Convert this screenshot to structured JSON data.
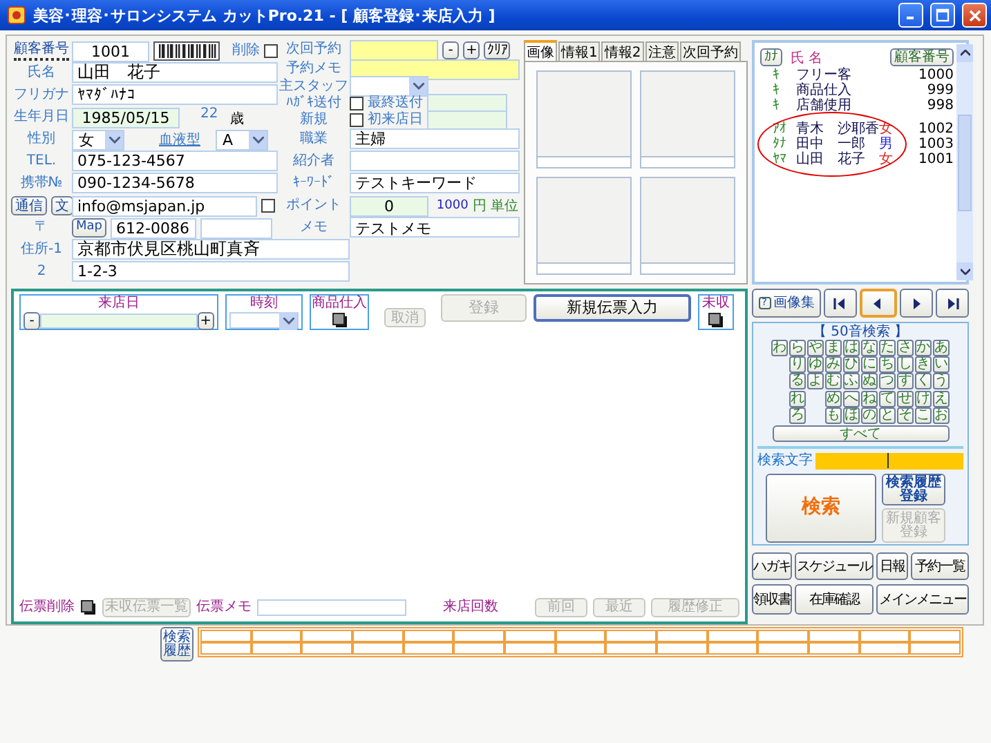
{
  "window": {
    "title": "美容･理容･サロンシステム カットPro.21 - [ 顧客登録･来店入力 ]"
  },
  "customer": {
    "id": {
      "label": "顧客番号",
      "value": "1001"
    },
    "delete": {
      "label": "削除",
      "checked": false
    },
    "name": {
      "label": "氏名",
      "value": "山田　花子"
    },
    "kana": {
      "label": "フリガナ",
      "value": "ﾔﾏﾀﾞﾊﾅｺ"
    },
    "birthday": {
      "label": "生年月日",
      "value": "1985/05/15"
    },
    "age": {
      "value": "22",
      "unit": "歳"
    },
    "sex": {
      "label": "性別",
      "value": "女"
    },
    "blood_type": {
      "label": "血液型",
      "value": "A"
    },
    "tel": {
      "label": "TEL.",
      "value": "075-123-4567"
    },
    "mobile": {
      "label": "携帯№",
      "value": "090-1234-5678"
    },
    "email": {
      "buttons": [
        {
          "label": "通信",
          "disabled": false
        },
        {
          "label": "文",
          "disabled": false
        }
      ],
      "value": "info@msjapan.jp",
      "checked": false
    },
    "zip": {
      "label": "〒",
      "button": "Map",
      "value": "612-0086"
    },
    "address1": {
      "label": "住所-1",
      "value": "京都市伏見区桃山町真斉"
    },
    "address2": {
      "label": "2",
      "value": "1-2-3"
    }
  },
  "details": {
    "next_reservation": {
      "label": "次回予約",
      "buttons": [
        "-",
        "+",
        "ｸﾘｱ"
      ]
    },
    "reservation_memo": {
      "label": "予約メモ"
    },
    "main_staff": {
      "label": "主スタッフ"
    },
    "postcard": {
      "label": "ﾊｶﾞｷ送付",
      "checked": false,
      "date_label": "最終送付"
    },
    "new_customer": {
      "label": "新規",
      "checked": false,
      "date_label": "初来店日"
    },
    "occupation": {
      "label": "職業",
      "value": "主婦"
    },
    "referrer": {
      "label": "紹介者"
    },
    "keyword": {
      "label": "ｷｰﾜｰﾄﾞ",
      "value": "テストキーワード"
    },
    "points": {
      "label": "ポイント",
      "value": "0",
      "unit_amount": "1000",
      "unit": "円 単位"
    },
    "memo": {
      "label": "メモ",
      "value": "テストメモ"
    }
  },
  "tabs": [
    {
      "label": "画像",
      "selected": true
    },
    {
      "label": "情報1",
      "selected": false
    },
    {
      "label": "情報2",
      "selected": false
    },
    {
      "label": "注意",
      "selected": false
    },
    {
      "label": "次回予約",
      "selected": false
    }
  ],
  "customer_list": {
    "kana_button": "ｶﾅ",
    "name_header": "氏 名",
    "id_button": "顧客番号",
    "rows": [
      {
        "kana": "ｷ",
        "name": "フリー客",
        "id": "1000",
        "circled": false
      },
      {
        "kana": "ｷ",
        "name": "商品仕入",
        "id": "999",
        "circled": false
      },
      {
        "kana": "ｷ",
        "name": "店舗使用",
        "id": "998",
        "circled": false
      },
      {
        "kana": "ｱｵ",
        "name": "青木　沙耶香",
        "sex": "女",
        "color": "#e02020",
        "id": "1002",
        "circled": true
      },
      {
        "kana": "ﾀﾅ",
        "name": "田中　一郎",
        "sex": "男",
        "color": "#2020e0",
        "id": "1003",
        "circled": true
      },
      {
        "kana": "ﾔﾏ",
        "name": "山田　花子",
        "sex": "女",
        "color": "#e02020",
        "id": "1001",
        "circled": true
      }
    ]
  },
  "visit": {
    "date_label": "来店日",
    "date_buttons": [
      "-",
      "+"
    ],
    "time_label": "時刻",
    "goods_label": "商品仕入",
    "buttons": [
      {
        "label": "取消",
        "disabled": true
      },
      {
        "label": "登録",
        "disabled": true
      },
      {
        "label": "新規伝票入力",
        "disabled": false
      }
    ],
    "unpaid_label": "未収"
  },
  "slip_bar": {
    "delete_label": "伝票削除",
    "unpaid_list": {
      "label": "未収伝票一覧",
      "disabled": true
    },
    "memo_label": "伝票メモ",
    "visits_label": "来店回数",
    "buttons": [
      {
        "label": "前回",
        "disabled": true
      },
      {
        "label": "最近",
        "disabled": true
      },
      {
        "label": "履歴修正",
        "disabled": true
      }
    ]
  },
  "image_collection": {
    "help": "?",
    "label": "画像集"
  },
  "navigation": [
    {
      "kind": "first",
      "selected": false
    },
    {
      "kind": "prev",
      "selected": true
    },
    {
      "kind": "next",
      "selected": false
    },
    {
      "kind": "last",
      "selected": false
    }
  ],
  "kana_search": {
    "title": "【 50音検索 】",
    "all": "すべて",
    "rows": [
      [
        {
          "kind": "key",
          "label": "わ"
        },
        {
          "kind": "key",
          "label": "ら"
        },
        {
          "kind": "key",
          "label": "や"
        },
        {
          "kind": "key",
          "label": "ま"
        },
        {
          "kind": "key",
          "label": "は"
        },
        {
          "kind": "key",
          "label": "な"
        },
        {
          "kind": "key",
          "label": "た"
        },
        {
          "kind": "key",
          "label": "さ"
        },
        {
          "kind": "key",
          "label": "か"
        },
        {
          "kind": "key",
          "label": "あ"
        }
      ],
      [
        {
          "kind": "gap"
        },
        {
          "kind": "key",
          "label": "り"
        },
        {
          "kind": "key",
          "label": "ゆ"
        },
        {
          "kind": "key",
          "label": "み"
        },
        {
          "kind": "key",
          "label": "ひ"
        },
        {
          "kind": "key",
          "label": "に"
        },
        {
          "kind": "key",
          "label": "ち"
        },
        {
          "kind": "key",
          "label": "し"
        },
        {
          "kind": "key",
          "label": "き"
        },
        {
          "kind": "key",
          "label": "い"
        }
      ],
      [
        {
          "kind": "gap"
        },
        {
          "kind": "key",
          "label": "る"
        },
        {
          "kind": "key",
          "label": "よ"
        },
        {
          "kind": "key",
          "label": "む"
        },
        {
          "kind": "key",
          "label": "ふ"
        },
        {
          "kind": "key",
          "label": "ぬ"
        },
        {
          "kind": "key",
          "label": "つ"
        },
        {
          "kind": "key",
          "label": "す"
        },
        {
          "kind": "key",
          "label": "く"
        },
        {
          "kind": "key",
          "label": "う"
        }
      ],
      [
        {
          "kind": "gap"
        },
        {
          "kind": "key",
          "label": "れ"
        },
        {
          "kind": "gap"
        },
        {
          "kind": "key",
          "label": "め"
        },
        {
          "kind": "key",
          "label": "へ"
        },
        {
          "kind": "key",
          "label": "ね"
        },
        {
          "kind": "key",
          "label": "て"
        },
        {
          "kind": "key",
          "label": "せ"
        },
        {
          "kind": "key",
          "label": "け"
        },
        {
          "kind": "key",
          "label": "え"
        }
      ],
      [
        {
          "kind": "gap"
        },
        {
          "kind": "key",
          "label": "ろ"
        },
        {
          "kind": "gap"
        },
        {
          "kind": "key",
          "label": "も"
        },
        {
          "kind": "key",
          "label": "ほ"
        },
        {
          "kind": "key",
          "label": "の"
        },
        {
          "kind": "key",
          "label": "と"
        },
        {
          "kind": "key",
          "label": "そ"
        },
        {
          "kind": "key",
          "label": "こ"
        },
        {
          "kind": "key",
          "label": "お"
        }
      ]
    ]
  },
  "search": {
    "label": "検索文字",
    "button": "検索",
    "history_button": {
      "label": "検索履歴登録",
      "disabled": false
    },
    "new_customer_button": {
      "label": "新規顧客登録",
      "disabled": true
    }
  },
  "menu_buttons": [
    {
      "label": "ハガキ"
    },
    {
      "label": "スケジュール"
    },
    {
      "label": "日報"
    },
    {
      "label": "予約一覧"
    },
    {
      "label": "領収書"
    },
    {
      "label": "在庫確認"
    },
    {
      "label": "メインメニュー"
    }
  ],
  "history": {
    "button": "検索履歴"
  }
}
